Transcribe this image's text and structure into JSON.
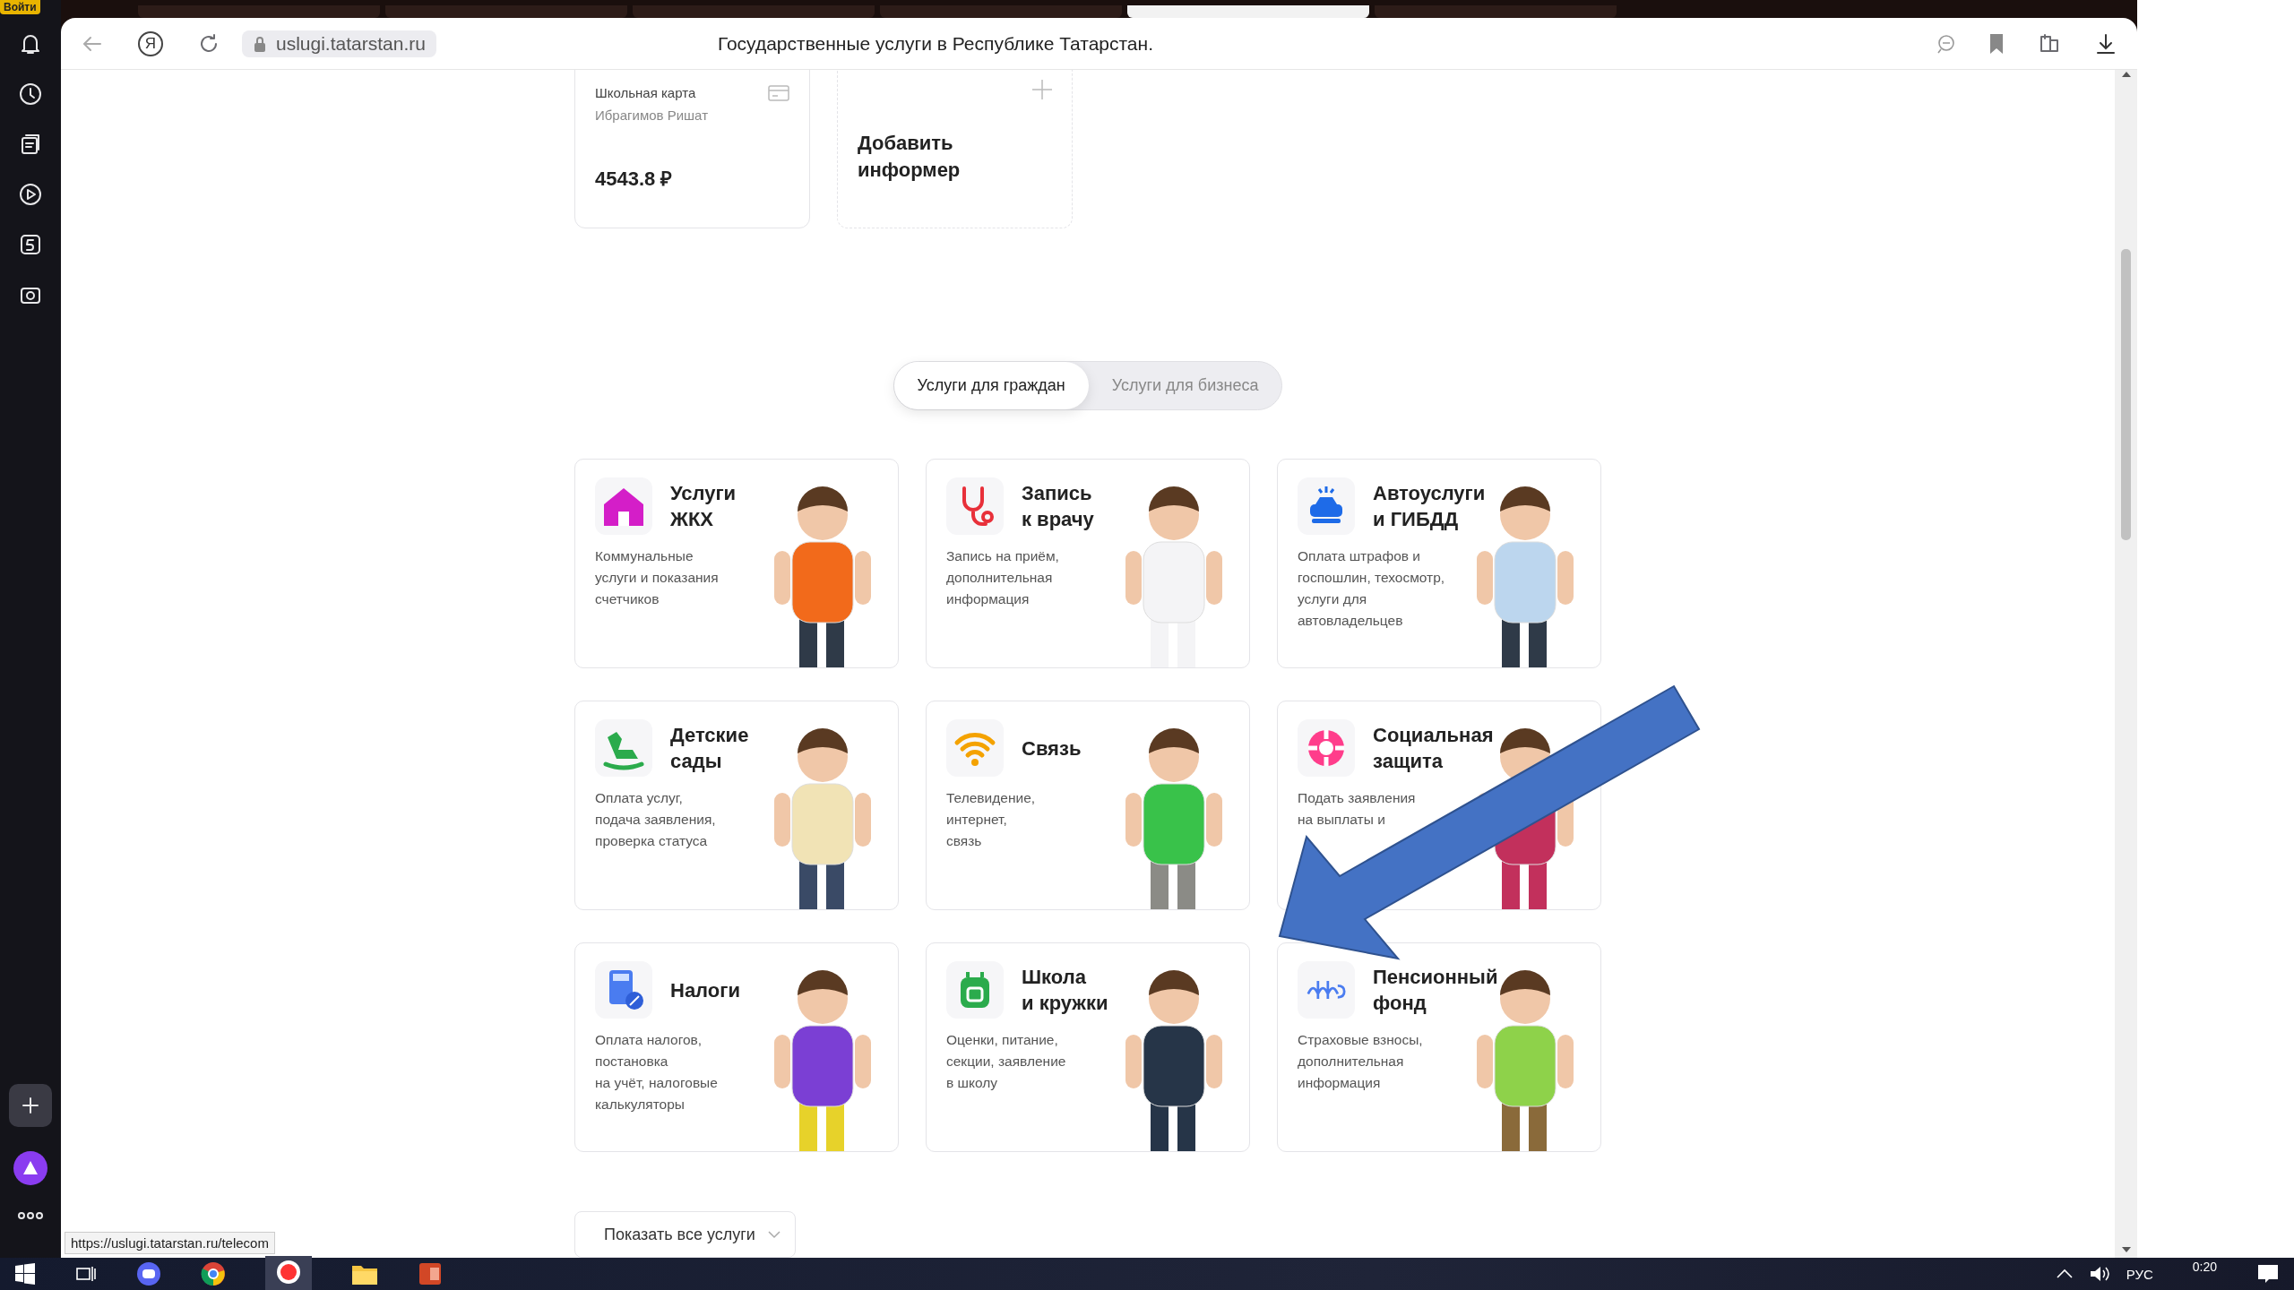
{
  "tab_strip": {
    "login_badge": "Войти"
  },
  "address_bar": {
    "yandex_button": "Я",
    "url": "uslugi.tatarstan.ru",
    "page_title": "Государственные услуги в Республике Татарстан."
  },
  "informers": [
    {
      "kind": "card",
      "title": "Школьная карта",
      "owner": "Ибрагимов Ришат",
      "balance": "4543.8 ₽"
    },
    {
      "kind": "add",
      "label": "Добавить информер"
    }
  ],
  "service_tabs": [
    {
      "label": "Услуги для граждан",
      "selected": true
    },
    {
      "label": "Услуги для бизнеса",
      "selected": false
    }
  ],
  "services": [
    {
      "kind": "house",
      "title": "Услуги\nЖКХ",
      "description": "Коммунальные\nуслуги и показания\nсчетчиков"
    },
    {
      "kind": "stethoscope",
      "title": "Запись\nк врачу",
      "description": "Запись на приём,\nдополнительная\nинформация"
    },
    {
      "kind": "car",
      "title": "Автоуслуги\nи ГИБДД",
      "description": "Оплата штрафов и\nгоспошлин, техосмотр,\nуслуги для\nавтовладельцев"
    },
    {
      "kind": "horse",
      "title": "Детские\nсады",
      "description": "Оплата услуг,\nподача заявления,\nпроверка статуса"
    },
    {
      "kind": "wifi",
      "title": "Связь",
      "description": "Телевидение,\nинтернет,\nсвязь"
    },
    {
      "kind": "lifebuoy",
      "title": "Социальная\nзащита",
      "description": "Подать заявления\nна выплаты и"
    },
    {
      "kind": "calculator",
      "title": "Налоги",
      "description": "Оплата налогов,\nпостановка\nна учёт, налоговые\nкалькуляторы"
    },
    {
      "kind": "backpack",
      "title": "Школа\nи кружки",
      "description": "Оценки, питание,\nсекции, заявление\nв школу"
    },
    {
      "kind": "pension",
      "title": "Пенсионный\nфонд",
      "description": "Страховые взносы,\nдополнительная\nинформация"
    }
  ],
  "show_all_button": "Показать все услуги",
  "status_url": "https://uslugi.tatarstan.ru/telecom",
  "taskbar": {
    "language": "РУС",
    "time": "0:20"
  }
}
